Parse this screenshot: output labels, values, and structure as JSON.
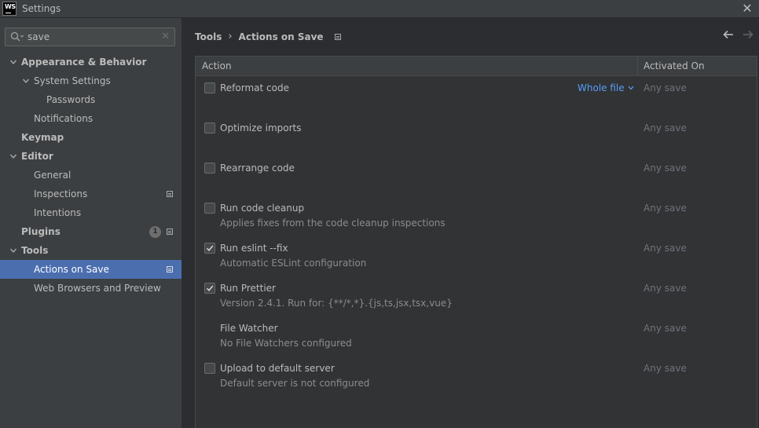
{
  "window": {
    "title": "Settings",
    "logo_text": "WS"
  },
  "sidebar": {
    "search": {
      "value": "save",
      "placeholder": ""
    },
    "items": [
      {
        "label": "Appearance & Behavior",
        "level": 0,
        "bold": true,
        "expandable": true,
        "expanded": true
      },
      {
        "label": "System Settings",
        "level": 1,
        "bold": false,
        "expandable": true,
        "expanded": true
      },
      {
        "label": "Passwords",
        "level": 2,
        "bold": false
      },
      {
        "label": "Notifications",
        "level": 1,
        "bold": false
      },
      {
        "label": "Keymap",
        "level": 0,
        "bold": true
      },
      {
        "label": "Editor",
        "level": 0,
        "bold": true,
        "expandable": true,
        "expanded": true
      },
      {
        "label": "General",
        "level": 1,
        "bold": false
      },
      {
        "label": "Inspections",
        "level": 1,
        "bold": false,
        "page_icon": true
      },
      {
        "label": "Intentions",
        "level": 1,
        "bold": false
      },
      {
        "label": "Plugins",
        "level": 0,
        "bold": true,
        "badge": "1",
        "page_icon": true
      },
      {
        "label": "Tools",
        "level": 0,
        "bold": true,
        "expandable": true,
        "expanded": true
      },
      {
        "label": "Actions on Save",
        "level": 1,
        "bold": false,
        "selected": true,
        "page_icon": true
      },
      {
        "label": "Web Browsers and Preview",
        "level": 1,
        "bold": false
      }
    ]
  },
  "breadcrumb": {
    "parent": "Tools",
    "separator": "›",
    "current": "Actions on Save"
  },
  "table": {
    "columns": {
      "action": "Action",
      "activated_on": "Activated On"
    },
    "rows": [
      {
        "title": "Reformat code",
        "subtitle": "",
        "checkbox": true,
        "checked": false,
        "scope": "Whole file",
        "activated_on": "Any save"
      },
      {
        "title": "Optimize imports",
        "subtitle": "",
        "checkbox": true,
        "checked": false,
        "activated_on": "Any save"
      },
      {
        "title": "Rearrange code",
        "subtitle": "",
        "checkbox": true,
        "checked": false,
        "activated_on": "Any save"
      },
      {
        "title": "Run code cleanup",
        "subtitle": "Applies fixes from the code cleanup inspections",
        "checkbox": true,
        "checked": false,
        "activated_on": "Any save"
      },
      {
        "title": "Run eslint --fix",
        "subtitle": "Automatic ESLint configuration",
        "checkbox": true,
        "checked": true,
        "activated_on": "Any save"
      },
      {
        "title": "Run Prettier",
        "subtitle": "Version 2.4.1. Run for: {**/*,*}.{js,ts,jsx,tsx,vue}",
        "checkbox": true,
        "checked": true,
        "activated_on": "Any save"
      },
      {
        "title": "File Watcher",
        "subtitle": "No File Watchers configured",
        "checkbox": false,
        "checked": false,
        "activated_on": "Any save"
      },
      {
        "title": "Upload to default server",
        "subtitle": "Default server is not configured",
        "checkbox": true,
        "checked": false,
        "activated_on": "Any save"
      }
    ]
  },
  "colors": {
    "selection": "#4b6eaf",
    "link": "#589df6",
    "sidebar_bg": "#3c3f41",
    "content_bg": "#2b2d30"
  },
  "icons": {
    "search": "search-icon",
    "clear": "clear-icon",
    "close": "close-icon",
    "back": "arrow-left-icon",
    "forward": "arrow-right-icon",
    "check": "checkmark-icon",
    "expand": "chevron-down-icon",
    "page": "page-icon"
  }
}
